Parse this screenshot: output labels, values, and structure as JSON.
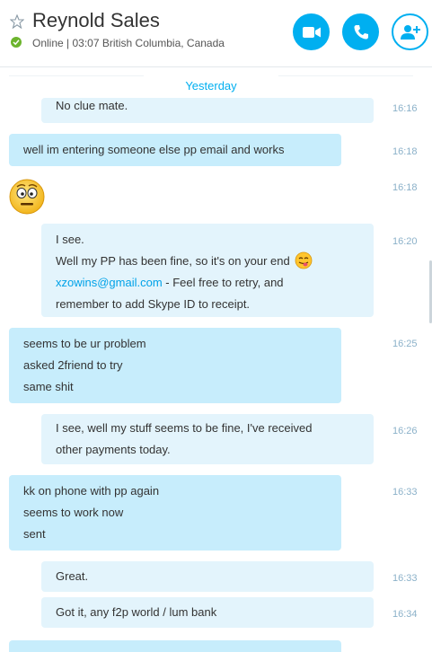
{
  "header": {
    "contact_name": "Reynold Sales",
    "status": "Online",
    "separator": "|",
    "local_time": "03:07",
    "location": "British Columbia, Canada",
    "accent_color": "#00aff0",
    "online_color": "#6cb42d"
  },
  "chat": {
    "day_label": "Yesterday",
    "messages": [
      {
        "dir": "out",
        "lines": [
          "No clue mate."
        ],
        "time": "16:16"
      },
      {
        "dir": "in",
        "lines": [
          "well im entering someone else pp email and works"
        ],
        "time": "16:18"
      },
      {
        "dir": "in",
        "emoji": "worried-face-emoji",
        "time": "16:18"
      },
      {
        "dir": "out",
        "lines": [
          "I see.",
          "Well my PP has been fine, so it's on your end",
          "xzowins@gmail.com",
          " - Feel free to retry, and",
          "remember to add Skype ID to receipt."
        ],
        "time": "16:20"
      },
      {
        "dir": "in",
        "lines": [
          "seems to be ur problem",
          "asked 2friend to try",
          "same shit"
        ],
        "time": "16:25"
      },
      {
        "dir": "out",
        "lines": [
          "I see, well my stuff seems to be fine, I've received",
          "other payments today."
        ],
        "time": "16:26"
      },
      {
        "dir": "in",
        "lines": [
          "kk on phone with pp again",
          "seems to work now",
          "sent"
        ],
        "time": "16:33"
      },
      {
        "dir": "out",
        "lines": [
          "Great."
        ],
        "time": "16:33"
      },
      {
        "dir": "out",
        "lines": [
          "Got it, any f2p world / lum bank"
        ],
        "time": "16:34"
      }
    ]
  }
}
